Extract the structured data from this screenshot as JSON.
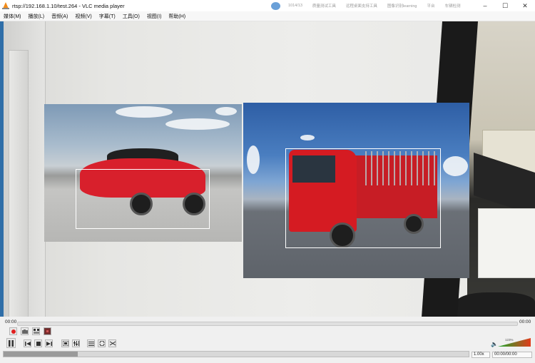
{
  "window": {
    "title": "rtsp://192.168.1.10/test.264 - VLC media player",
    "background_tabs": [
      "1014/13",
      "质量测试工具",
      "远程桌面支持工具",
      "图像识别learning",
      "平台",
      "车辆检测"
    ],
    "minimize": "–",
    "maximize": "☐",
    "close": "✕"
  },
  "menu": [
    "媒体(M)",
    "播放(L)",
    "音频(A)",
    "视频(V)",
    "字幕(T)",
    "工具(O)",
    "视图(I)",
    "帮助(H)"
  ],
  "playback": {
    "elapsed": "00:00",
    "total": "00:00",
    "speed": "1.00x",
    "time_display": "00:00/00:00",
    "volume_percent": "123%",
    "volume_level": 1.0,
    "progress_level": 0.16
  },
  "colors": {
    "record": "#e02020",
    "volume_start": "#1aa82a",
    "volume_end": "#e23c1c"
  },
  "icons": {
    "record": "record-icon",
    "snapshot": "snapshot-icon",
    "loop_ab": "loop-ab-icon",
    "frame_step": "frame-step-icon",
    "pause": "pause-icon",
    "prev": "previous-icon",
    "stop": "stop-icon",
    "next": "next-icon",
    "fullscreen": "fullscreen-icon",
    "extended": "extended-settings-icon",
    "playlist": "playlist-icon",
    "loop": "loop-icon",
    "shuffle": "shuffle-icon",
    "speaker": "speaker-icon"
  }
}
